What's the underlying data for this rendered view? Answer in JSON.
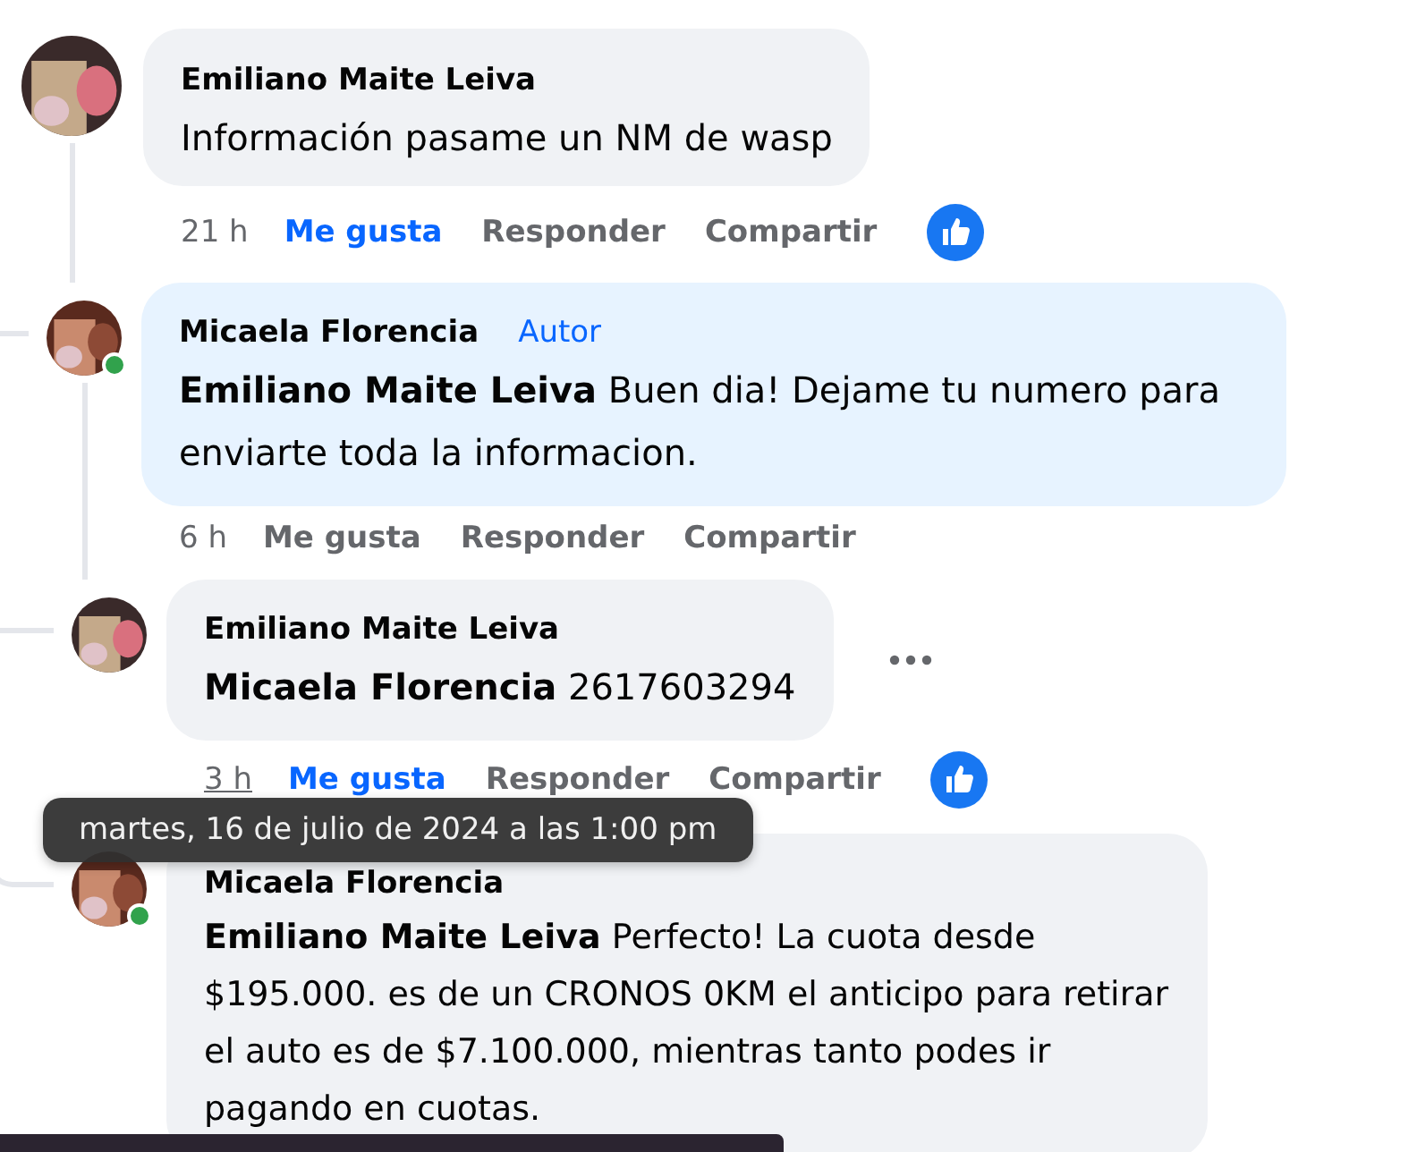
{
  "comments": [
    {
      "author": "Emiliano Maite Leiva",
      "text": "Información pasame un NM de wasp",
      "time": "21 h",
      "time_hovered": false,
      "actions": [
        "Me gusta",
        "Responder",
        "Compartir"
      ],
      "liked": true,
      "has_reaction": true,
      "children": [
        {
          "author": "Micaela Florencia",
          "badge": "Autor",
          "online": true,
          "text": "**Emiliano Maite Leiva** Buen dia! Dejame tu numero para enviarte toda la informacion.",
          "time": "6 h",
          "time_hovered": false,
          "actions": [
            "Me gusta",
            "Responder",
            "Compartir"
          ],
          "liked": false,
          "children": [
            {
              "author": "Emiliano Maite Leiva",
              "text": "**Micaela Florencia** 2617603294",
              "time": "3 h",
              "time_hovered": true,
              "actions": [
                "Me gusta",
                "Responder",
                "Compartir"
              ],
              "liked": true,
              "has_reaction": true,
              "show_more": true
            },
            {
              "author": "Micaela Florencia",
              "online": true,
              "text": "**Emiliano Maite Leiva** Perfecto! La cuota desde $195.000. es de un CRONOS 0KM el anticipo para retirar el auto es de $7.100.000, mientras tanto podes ir pagando en cuotas."
            }
          ]
        }
      ]
    }
  ],
  "tooltip": "martes, 16 de julio de 2024 a las 1:00 pm"
}
